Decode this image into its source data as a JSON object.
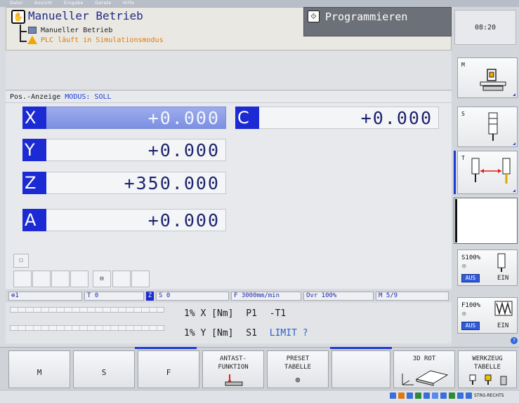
{
  "menubar": [
    "Datei",
    "Ansicht",
    "Eingabe",
    "Gerate",
    "Hilfe"
  ],
  "header": {
    "mode_title": "Manueller Betrieb",
    "sub_line1": "Manueller Betrieb",
    "sub_line2": "PLC läuft in Simulationsmodus",
    "program_label": "Programmieren",
    "clock": "08:20"
  },
  "position": {
    "label": "Pos.-Anzeige",
    "mode": "MODUS: SOLL",
    "axes": [
      {
        "letter": "X",
        "value": "+0.000"
      },
      {
        "letter": "Y",
        "value": "+0.000"
      },
      {
        "letter": "Z",
        "value": "+350.000"
      },
      {
        "letter": "A",
        "value": "+0.000"
      },
      {
        "letter": "C",
        "value": "+0.000"
      }
    ]
  },
  "status": {
    "preset": "1",
    "tool": "T 0",
    "z_badge": "Z",
    "spindle": "S 0",
    "feed": "F 3000mm/min",
    "override": "Ovr 100%",
    "mfunc": "M 5/9"
  },
  "info": {
    "line1": {
      "pct": "1%",
      "axis": "X",
      "unit": "[Nm]",
      "p": "P1",
      "extra": "-T1"
    },
    "line2": {
      "pct": "1%",
      "axis": "Y",
      "unit": "[Nm]",
      "p": "S1",
      "extra": "LIMIT ?"
    }
  },
  "sidebar": {
    "m_tag": "M",
    "s_tag": "S",
    "t_tag": "T",
    "s_override": "S100%",
    "f_override": "F100%",
    "aus": "AUS",
    "ein": "EIN"
  },
  "softkeys": {
    "m": "M",
    "s": "S",
    "f": "F",
    "antast": [
      "ANTAST-",
      "FUNKTION"
    ],
    "preset": [
      "PRESET",
      "TABELLE"
    ],
    "rot": "3D ROT",
    "werkzeug": [
      "WERKZEUG",
      "TABELLE"
    ]
  },
  "taskbar": {
    "text": "STRG-RECHTS"
  }
}
